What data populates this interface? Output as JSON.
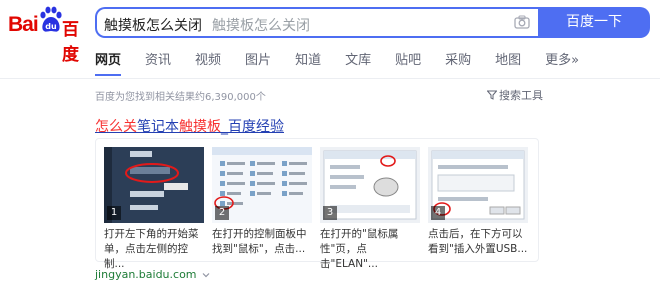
{
  "logo": {
    "text1": "Bai",
    "text2": "百度"
  },
  "search": {
    "query": "触摸板怎么关闭",
    "suggestion": "触摸板怎么关闭",
    "button": "百度一下"
  },
  "tabs": [
    {
      "label": "网页",
      "active": true
    },
    {
      "label": "资讯"
    },
    {
      "label": "视频"
    },
    {
      "label": "图片"
    },
    {
      "label": "知道"
    },
    {
      "label": "文库"
    },
    {
      "label": "贴吧"
    },
    {
      "label": "采购"
    },
    {
      "label": "地图"
    },
    {
      "label": "更多»"
    }
  ],
  "result_count": "百度为您找到相关结果约6,390,000个",
  "tools_label": "搜索工具",
  "result": {
    "title_parts": [
      "怎么关",
      "笔记本",
      "触摸板",
      "_百度经验"
    ],
    "steps": [
      {
        "num": "1",
        "caption": "打开左下角的开始菜单，点击左侧的控制..."
      },
      {
        "num": "2",
        "caption": "在打开的控制面板中找到\"鼠标\"，点击..."
      },
      {
        "num": "3",
        "caption": "在打开的\"鼠标属性\"页，点击\"ELAN\"..."
      },
      {
        "num": "4",
        "caption": "点击后，在下方可以看到\"插入外置USB..."
      }
    ],
    "site": "jingyan.baidu.com"
  },
  "colors": {
    "brand_red": "#e10601",
    "brand_blue": "#4e6ef2",
    "link": "#2440b3",
    "highlight": "#f73131",
    "site_green": "#1e7c37"
  }
}
